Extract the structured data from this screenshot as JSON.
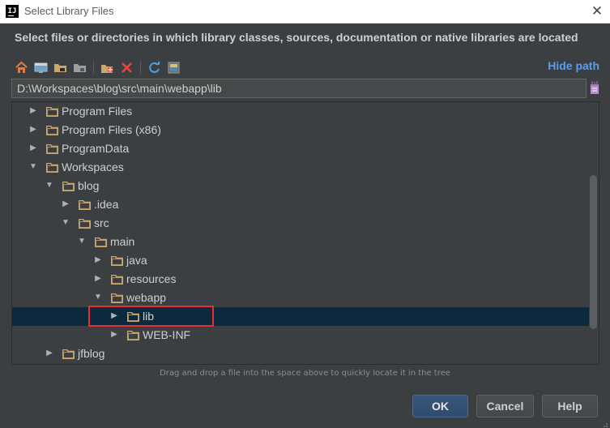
{
  "window": {
    "title": "Select Library Files",
    "app_icon_text": "IJ"
  },
  "instruction": "Select files or directories in which library classes, sources, documentation or native libraries are located",
  "toolbar": {
    "icons": [
      "home-icon",
      "desktop-icon",
      "project-folder-icon",
      "module-folder-icon",
      "new-folder-icon",
      "delete-icon",
      "refresh-icon",
      "show-hidden-icon"
    ],
    "hide_path_label": "Hide path"
  },
  "path": {
    "value": "D:\\Workspaces\\blog\\src\\main\\webapp\\lib"
  },
  "tree": {
    "rows": [
      {
        "label": "Program Files",
        "expanded": false,
        "depth": 0
      },
      {
        "label": "Program Files (x86)",
        "expanded": false,
        "depth": 0
      },
      {
        "label": "ProgramData",
        "expanded": false,
        "depth": 0
      },
      {
        "label": "Workspaces",
        "expanded": true,
        "depth": 0
      },
      {
        "label": "blog",
        "expanded": true,
        "depth": 1
      },
      {
        "label": ".idea",
        "expanded": false,
        "depth": 2
      },
      {
        "label": "src",
        "expanded": true,
        "depth": 2
      },
      {
        "label": "main",
        "expanded": true,
        "depth": 3
      },
      {
        "label": "java",
        "expanded": false,
        "depth": 4
      },
      {
        "label": "resources",
        "expanded": false,
        "depth": 4
      },
      {
        "label": "webapp",
        "expanded": true,
        "depth": 4
      },
      {
        "label": "lib",
        "expanded": false,
        "depth": 5,
        "selected": true
      },
      {
        "label": "WEB-INF",
        "expanded": false,
        "depth": 5
      },
      {
        "label": "jfblog",
        "expanded": false,
        "depth": 1
      }
    ]
  },
  "hint": "Drag and drop a file into the space above to quickly locate it in the tree",
  "buttons": {
    "ok": "OK",
    "cancel": "Cancel",
    "help": "Help"
  },
  "colors": {
    "background": "#3c3f41",
    "selection": "#0d293e",
    "link": "#589df6",
    "highlight_border": "#e53030",
    "folder": "#c9a86a"
  }
}
